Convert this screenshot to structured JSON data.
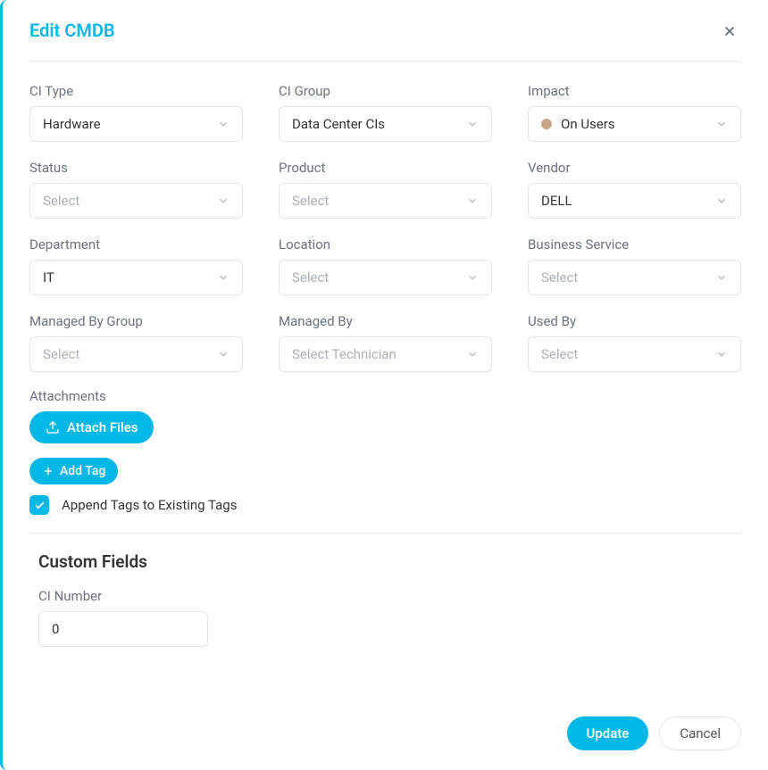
{
  "header": {
    "title": "Edit CMDB"
  },
  "fields": {
    "ci_type": {
      "label": "CI Type",
      "value": "Hardware"
    },
    "ci_group": {
      "label": "CI Group",
      "value": "Data Center CIs"
    },
    "impact": {
      "label": "Impact",
      "value": "On Users",
      "dot_color": "#c7a689"
    },
    "status": {
      "label": "Status",
      "placeholder": "Select"
    },
    "product": {
      "label": "Product",
      "placeholder": "Select"
    },
    "vendor": {
      "label": "Vendor",
      "value": "DELL"
    },
    "department": {
      "label": "Department",
      "value": "IT"
    },
    "location": {
      "label": "Location",
      "placeholder": "Select"
    },
    "business_service": {
      "label": "Business Service",
      "placeholder": "Select"
    },
    "managed_by_group": {
      "label": "Managed By Group",
      "placeholder": "Select"
    },
    "managed_by": {
      "label": "Managed By",
      "placeholder": "Select Technician"
    },
    "used_by": {
      "label": "Used By",
      "placeholder": "Select"
    }
  },
  "attachments": {
    "label": "Attachments",
    "button": "Attach Files"
  },
  "tags": {
    "add_button": "Add Tag",
    "append_label": "Append Tags to Existing Tags",
    "append_checked": true
  },
  "custom_fields": {
    "title": "Custom Fields",
    "ci_number": {
      "label": "CI Number",
      "value": "0"
    }
  },
  "footer": {
    "update": "Update",
    "cancel": "Cancel"
  }
}
